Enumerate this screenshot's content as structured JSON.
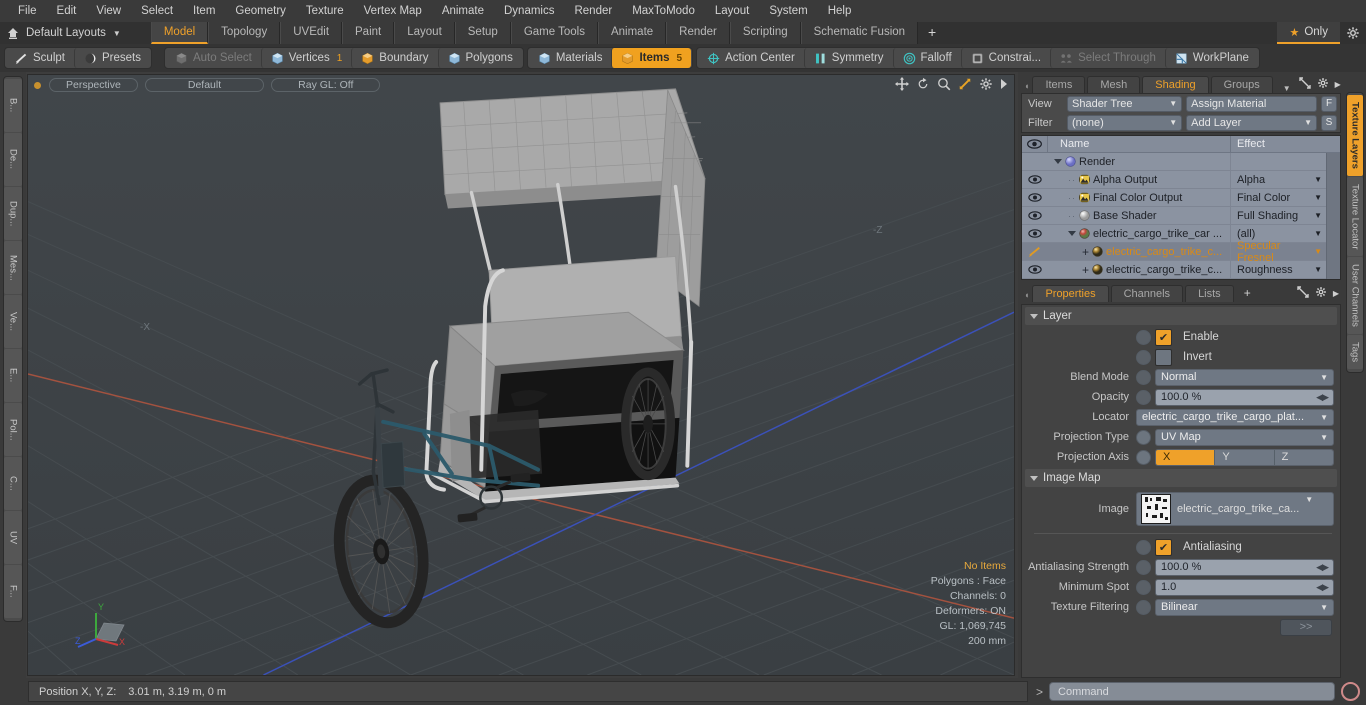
{
  "menubar": [
    "File",
    "Edit",
    "View",
    "Select",
    "Item",
    "Geometry",
    "Texture",
    "Vertex Map",
    "Animate",
    "Dynamics",
    "Render",
    "MaxToModo",
    "Layout",
    "System",
    "Help"
  ],
  "layoutbar": {
    "home_icon": "home-icon",
    "layout_label": "Default Layouts",
    "tabs": [
      {
        "label": "Model",
        "active": true
      },
      {
        "label": "Topology",
        "active": false
      },
      {
        "label": "UVEdit",
        "active": false
      },
      {
        "label": "Paint",
        "active": false
      },
      {
        "label": "Layout",
        "active": false
      },
      {
        "label": "Setup",
        "active": false
      },
      {
        "label": "Game Tools",
        "active": false
      },
      {
        "label": "Animate",
        "active": false
      },
      {
        "label": "Render",
        "active": false
      },
      {
        "label": "Scripting",
        "active": false
      },
      {
        "label": "Schematic Fusion",
        "active": false
      }
    ],
    "add_tab": "+",
    "only_label": "Only",
    "gear_icon": "gear-icon"
  },
  "modebar": {
    "group_left": [
      {
        "label": "Sculpt",
        "icon": "brush-icon",
        "state": "normal"
      },
      {
        "label": "Presets",
        "icon": "sphere-icon",
        "state": "normal"
      }
    ],
    "group_select": [
      {
        "label": "Auto Select",
        "icon": "cube-icon",
        "state": "dim",
        "count": ""
      },
      {
        "label": "Vertices",
        "icon": "cube-blue-icon",
        "state": "normal",
        "count": "1"
      },
      {
        "label": "Boundary",
        "icon": "cube-orange-icon",
        "state": "normal",
        "count": ""
      },
      {
        "label": "Polygons",
        "icon": "cube-blue-icon",
        "state": "normal",
        "count": ""
      }
    ],
    "group_items": [
      {
        "label": "Materials",
        "icon": "cube-blue-icon",
        "state": "normal",
        "count": ""
      },
      {
        "label": "Items",
        "icon": "cube-orange-icon",
        "state": "selected",
        "count": "5"
      }
    ],
    "group_tools": [
      {
        "label": "Action Center",
        "icon": "target-icon",
        "state": "normal"
      },
      {
        "label": "Symmetry",
        "icon": "mirror-icon",
        "state": "normal"
      },
      {
        "label": "Falloff",
        "icon": "circles-icon",
        "state": "normal"
      },
      {
        "label": "Constrai...",
        "icon": "constraint-icon",
        "state": "normal"
      },
      {
        "label": "Select Through",
        "icon": "selectthrough-icon",
        "state": "dim"
      },
      {
        "label": "WorkPlane",
        "icon": "workplane-icon",
        "state": "normal"
      }
    ]
  },
  "left_toolbox_tabs": [
    "B...",
    "De...",
    "Dup...",
    "Mes...",
    "Ve...",
    "E...",
    "Pol...",
    "C...",
    "UV",
    "F..."
  ],
  "viewport": {
    "projection": "Perspective",
    "shading": "Default",
    "raygl": "Ray GL: Off",
    "icons": [
      "move-icon",
      "rotate-icon",
      "zoom-icon",
      "fit-icon",
      "gear-icon",
      "chevron-right-icon"
    ],
    "axis_left": "-X",
    "axis_right": "-Z",
    "gizmo_axes": [
      "X",
      "Y",
      "Z"
    ],
    "stats": {
      "selection": "No Items",
      "polygons": "Polygons : Face",
      "channels": "Channels: 0",
      "deformers": "Deformers: ON",
      "gl": "GL: 1,069,745",
      "scale": "200 mm"
    }
  },
  "right_panel": {
    "tabs": [
      {
        "label": "Items",
        "active": false
      },
      {
        "label": "Mesh ...",
        "active": false
      },
      {
        "label": "Shading",
        "active": true
      },
      {
        "label": "Groups",
        "active": false
      }
    ],
    "add_tab": "+",
    "expand_icon": "expand-icon",
    "gear_icon": "gear-icon",
    "chevron_icon": "chevron-right-icon",
    "controls": {
      "view_label": "View",
      "view_value": "Shader Tree",
      "assign_material": "Assign Material",
      "f_button": "F",
      "filter_label": "Filter",
      "filter_value": "(none)",
      "add_layer": "Add Layer",
      "s_button": "S"
    },
    "tree": {
      "header": {
        "eye": "eye-icon",
        "name": "Name",
        "effect": "Effect"
      },
      "rows": [
        {
          "eye": false,
          "indent": 0,
          "expander": "down",
          "icon": "render-globe",
          "name": "Render",
          "effect": "",
          "dropdown": false,
          "selected": false,
          "amber": false
        },
        {
          "eye": true,
          "indent": 1,
          "expander": "",
          "icon": "image-output",
          "name": "Alpha Output",
          "effect": "Alpha",
          "dropdown": true,
          "selected": false,
          "amber": false
        },
        {
          "eye": true,
          "indent": 1,
          "expander": "",
          "icon": "image-output",
          "name": "Final Color Output",
          "effect": "Final Color",
          "dropdown": true,
          "selected": false,
          "amber": false
        },
        {
          "eye": true,
          "indent": 1,
          "expander": "",
          "icon": "base-shader",
          "name": "Base Shader",
          "effect": "Full Shading",
          "dropdown": true,
          "selected": false,
          "amber": false
        },
        {
          "eye": true,
          "indent": 1,
          "expander": "down",
          "icon": "material-ball",
          "name": "electric_cargo_trike_car ...",
          "effect": "(all)",
          "dropdown": true,
          "selected": false,
          "amber": false
        },
        {
          "eye": "brush",
          "indent": 2,
          "expander": "plus",
          "icon": "texture-ball",
          "name": "electric_cargo_trike_c...",
          "effect": "Specular Fresnel",
          "dropdown": true,
          "selected": true,
          "amber": true
        },
        {
          "eye": true,
          "indent": 2,
          "expander": "plus",
          "icon": "texture-ball",
          "name": "electric_cargo_trike_c...",
          "effect": "Roughness",
          "dropdown": true,
          "selected": false,
          "amber": false
        }
      ]
    }
  },
  "properties": {
    "tabs": [
      {
        "label": "Properties",
        "active": true
      },
      {
        "label": "Channels",
        "active": false
      },
      {
        "label": "Lists",
        "active": false
      }
    ],
    "add_tab": "+",
    "sections": [
      {
        "title": "Layer"
      },
      {
        "title": "Image Map"
      }
    ],
    "layer": {
      "enable_label": "Enable",
      "enable_checked": true,
      "invert_label": "Invert",
      "invert_checked": false,
      "blend_mode_label": "Blend Mode",
      "blend_mode_value": "Normal",
      "opacity_label": "Opacity",
      "opacity_value": "100.0 %",
      "locator_label": "Locator",
      "locator_value": "electric_cargo_trike_cargo_plat...",
      "projection_type_label": "Projection Type",
      "projection_type_value": "UV Map",
      "projection_axis_label": "Projection Axis",
      "projection_axis_options": [
        "X",
        "Y",
        "Z"
      ],
      "projection_axis_selected": "X"
    },
    "image_map": {
      "image_label": "Image",
      "image_value": "electric_cargo_trike_ca...",
      "antialiasing_label": "Antialiasing",
      "antialiasing_checked": true,
      "aa_strength_label": "Antialiasing Strength",
      "aa_strength_value": "100.0 %",
      "min_spot_label": "Minimum Spot",
      "min_spot_value": "1.0",
      "texture_filtering_label": "Texture Filtering",
      "texture_filtering_value": "Bilinear",
      "more_button": ">>"
    }
  },
  "right_vtabs": [
    {
      "label": "Texture Layers",
      "active": true
    },
    {
      "label": "Texture Locator",
      "active": false
    },
    {
      "label": "User Channels",
      "active": false
    },
    {
      "label": "Tags",
      "active": false
    }
  ],
  "statusbar": {
    "position_label": "Position X, Y, Z:",
    "position_value": "3.01 m, 3.19 m, 0 m",
    "command_prompt": ">",
    "command_placeholder": "Command",
    "record_icon": "record-icon"
  },
  "colors": {
    "accent": "#efa12a",
    "panel_bg": "#3a3a3a",
    "tree_bg": "#8b93a1",
    "viewport_bg": "#3e4347",
    "axis_x": "#b55a4a",
    "axis_z": "#3b53c4"
  }
}
